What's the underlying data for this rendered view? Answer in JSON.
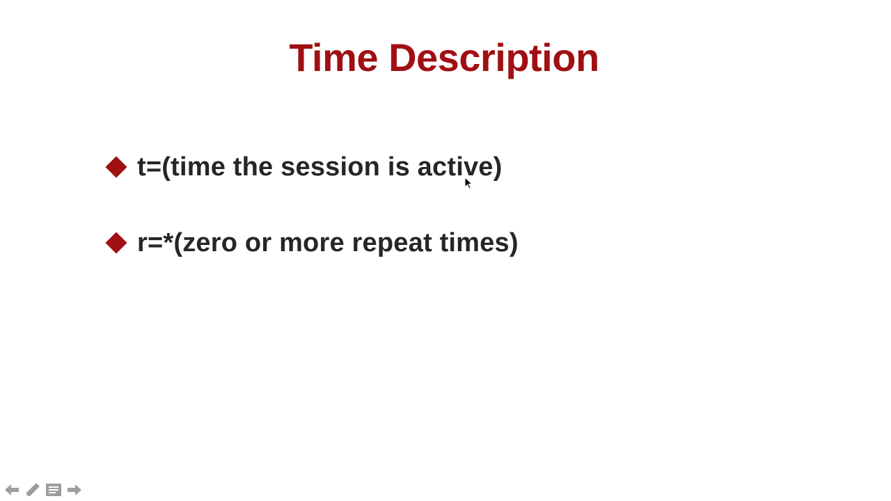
{
  "slide": {
    "title": "Time Description",
    "bullets": [
      {
        "text": "t=(time the session is active)"
      },
      {
        "text": "r=*(zero or more repeat times)"
      }
    ]
  },
  "icons": {
    "bullet": "diamond-icon",
    "cursor": "mouse-pointer-icon",
    "previous": "arrow-left-icon",
    "pen": "pen-icon",
    "menu": "slide-menu-icon",
    "next": "arrow-right-icon"
  },
  "colors": {
    "title": "#a00f12",
    "bullet_marker": "#a00f12",
    "bullet_text": "#262626",
    "background": "#ffffff",
    "nav_icons": "#8c8c8c"
  }
}
